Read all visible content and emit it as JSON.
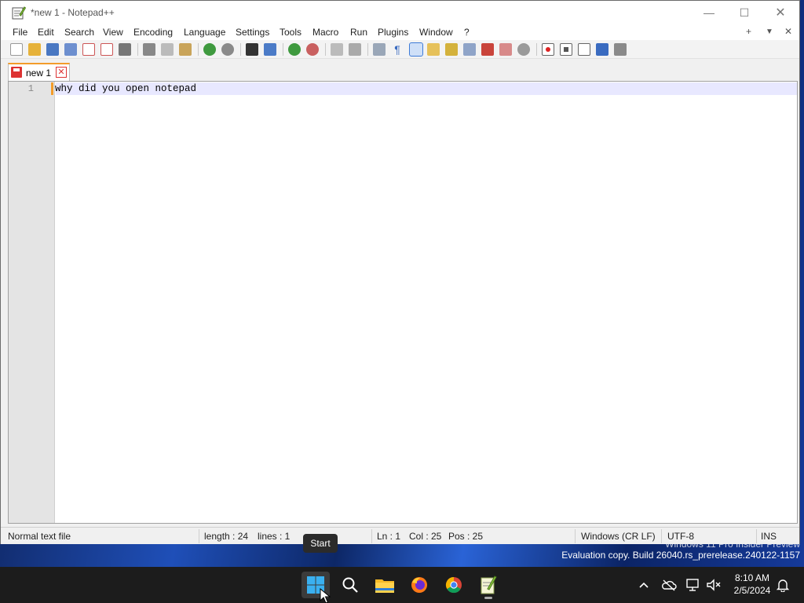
{
  "window": {
    "title": "*new 1 - Notepad++",
    "minimize_glyph": "—",
    "maximize_glyph": "☐",
    "close_glyph": "✕"
  },
  "menu": {
    "items": [
      "File",
      "Edit",
      "Search",
      "View",
      "Encoding",
      "Language",
      "Settings",
      "Tools",
      "Macro",
      "Run",
      "Plugins",
      "Window",
      "?"
    ],
    "right_add": "+",
    "right_dropdown": "▼",
    "right_close": "✕"
  },
  "tab": {
    "label": "new 1",
    "close_glyph": "✕"
  },
  "editor": {
    "line_number": "1",
    "line_text": "why did you open notepad"
  },
  "status": {
    "file_type": "Normal text file",
    "length": "length : 24",
    "lines": "lines : 1",
    "ln": "Ln : 1",
    "col": "Col : 25",
    "pos": "Pos : 25",
    "eol": "Windows (CR LF)",
    "encoding": "UTF-8",
    "mode": "INS"
  },
  "tooltip": "Start",
  "watermark": {
    "line1": "Windows 11 Pro Insider Preview",
    "line2": "Evaluation copy. Build 26040.rs_prerelease.240122-1157"
  },
  "clock": {
    "time": "8:10 AM",
    "date": "2/5/2024"
  },
  "colors": {
    "accent_orange": "#f39c2a",
    "tab_red": "#dd3333",
    "taskbar": "#1c1c1c"
  }
}
